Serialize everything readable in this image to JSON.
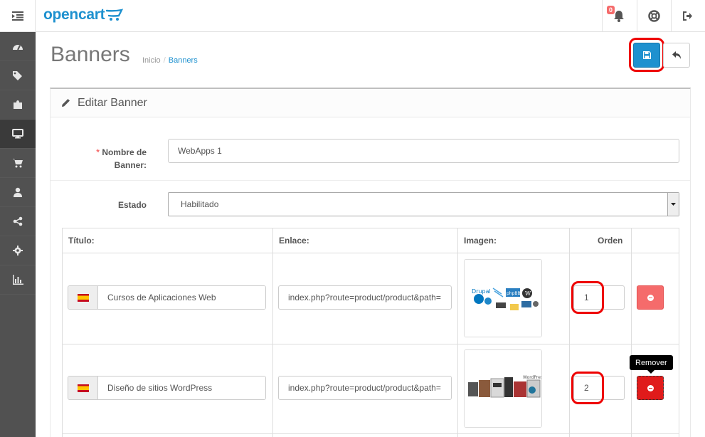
{
  "header": {
    "logo_text": "opencart",
    "notification_count": "0"
  },
  "sidebar": {
    "items": [
      {
        "icon": "dashboard-icon"
      },
      {
        "icon": "tags-icon"
      },
      {
        "icon": "puzzle-icon"
      },
      {
        "icon": "desktop-icon",
        "active": true
      },
      {
        "icon": "cart-icon"
      },
      {
        "icon": "user-icon"
      },
      {
        "icon": "share-icon"
      },
      {
        "icon": "gear-icon"
      },
      {
        "icon": "bar-chart-icon"
      }
    ]
  },
  "page": {
    "title": "Banners",
    "breadcrumb": [
      "Inicio",
      "Banners"
    ]
  },
  "panel": {
    "heading": "Editar Banner",
    "name_label_req": "*",
    "name_label_1": "Nombre de",
    "name_label_2": "Banner:",
    "name_value": "WebApps 1",
    "status_label": "Estado",
    "status_value": "Habilitado"
  },
  "table": {
    "headers": [
      "Título:",
      "Enlace:",
      "Imagen:",
      "Orden"
    ],
    "rows": [
      {
        "title": "Cursos de Aplicaciones Web",
        "link": "index.php?route=product/product&path=",
        "order": "1"
      },
      {
        "title": "Diseño de sitios WordPress",
        "link": "index.php?route=product/product&path=",
        "order": "2"
      }
    ]
  },
  "tooltip": "Remover",
  "colors": {
    "primary": "#1e91cf",
    "danger": "#f56b6b",
    "sidebar": "#515151",
    "highlight": "#ee0000"
  }
}
